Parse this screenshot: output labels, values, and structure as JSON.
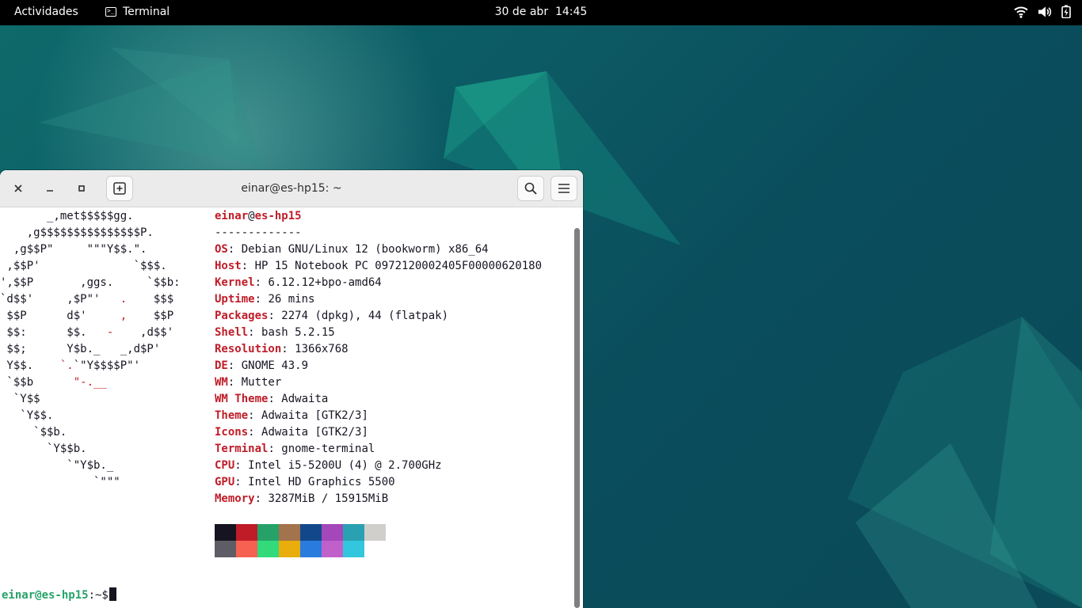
{
  "topbar": {
    "activities": "Actividades",
    "app_name": "Terminal",
    "app_icon": "terminal-icon",
    "date": "30 de abr",
    "time": "14:45",
    "status_icons": [
      "wifi-icon",
      "volume-icon",
      "battery-icon"
    ]
  },
  "window": {
    "title": "einar@es-hp15: ~",
    "buttons": [
      "close-icon",
      "minimize-icon",
      "maximize-icon",
      "new-tab-icon",
      "search-icon",
      "menu-icon"
    ]
  },
  "logo": [
    "       _,met$$$$$gg.",
    "    ,g$$$$$$$$$$$$$$$P.",
    "  ,g$$P\"     \"\"\"Y$$.\".",
    " ,$$P'              `$$$.",
    "',$$P       ,ggs.     `$$b:",
    "`d$$'     ,$P\"'   .    $$$",
    " $$P      d$'     ,    $$P",
    " $$:      $$.   -    ,d$$'",
    " $$;      Y$b._   _,d$P'",
    " Y$$.    `.`\"Y$$$$P\"'",
    " `$$b      \"-.__",
    "  `Y$$",
    "   `Y$$.",
    "     `$$b.",
    "       `Y$$b.",
    "          `\"Y$b._",
    "              `\"\"\""
  ],
  "neofetch": {
    "user": "einar",
    "at": "@",
    "host": "es-hp15",
    "separator": "-------------",
    "info": [
      {
        "key": "OS",
        "value": "Debian GNU/Linux 12 (bookworm) x86_64"
      },
      {
        "key": "Host",
        "value": "HP 15 Notebook PC 0972120002405F00000620180"
      },
      {
        "key": "Kernel",
        "value": "6.12.12+bpo-amd64"
      },
      {
        "key": "Uptime",
        "value": "26 mins"
      },
      {
        "key": "Packages",
        "value": "2274 (dpkg), 44 (flatpak)"
      },
      {
        "key": "Shell",
        "value": "bash 5.2.15"
      },
      {
        "key": "Resolution",
        "value": "1366x768"
      },
      {
        "key": "DE",
        "value": "GNOME 43.9"
      },
      {
        "key": "WM",
        "value": "Mutter"
      },
      {
        "key": "WM Theme",
        "value": "Adwaita"
      },
      {
        "key": "Theme",
        "value": "Adwaita [GTK2/3]"
      },
      {
        "key": "Icons",
        "value": "Adwaita [GTK2/3]"
      },
      {
        "key": "Terminal",
        "value": "gnome-terminal"
      },
      {
        "key": "CPU",
        "value": "Intel i5-5200U (4) @ 2.700GHz"
      },
      {
        "key": "GPU",
        "value": "Intel HD Graphics 5500"
      },
      {
        "key": "Memory",
        "value": "3287MiB / 15915MiB"
      }
    ],
    "palette_row1": [
      "#171421",
      "#c01c28",
      "#26a269",
      "#a2734c",
      "#12488b",
      "#a347ba",
      "#2aa1b3",
      "#d0cfcc"
    ],
    "palette_row2": [
      "#5e5c64",
      "#f66151",
      "#33da7a",
      "#e9ad0c",
      "#2a7bde",
      "#c061cb",
      "#33c7de",
      "#ffffff"
    ]
  },
  "prompt": {
    "userhost": "einar@es-hp15",
    "path": ":~$"
  }
}
